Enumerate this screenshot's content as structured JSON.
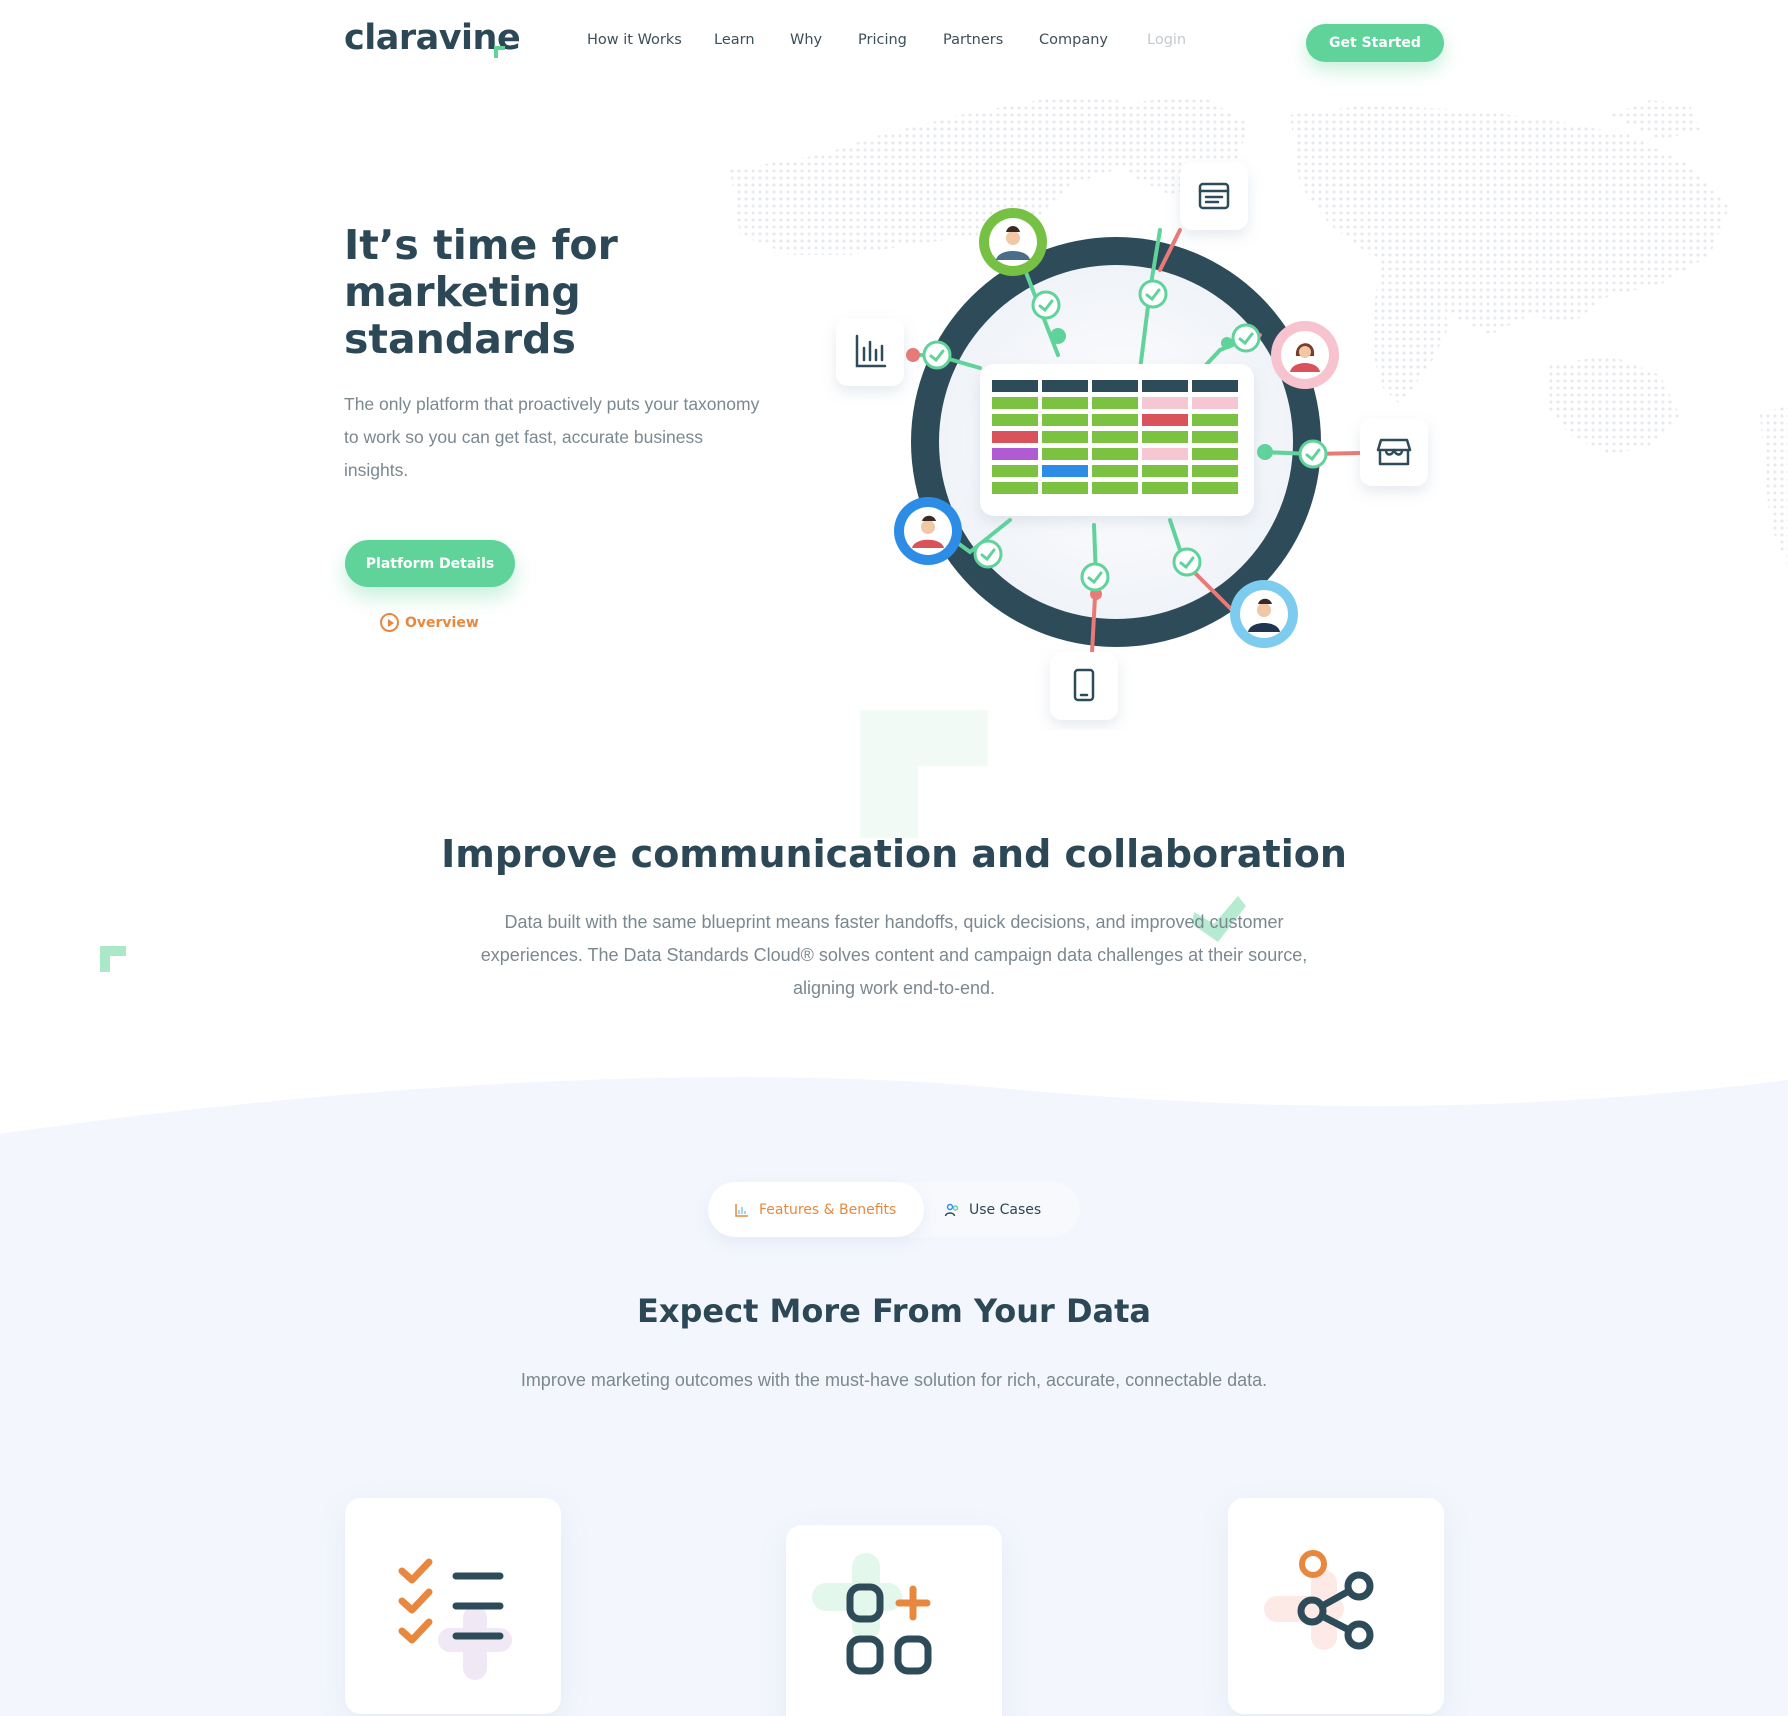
{
  "header": {
    "logo": "claravine",
    "nav": [
      "How it Works",
      "Learn",
      "Why",
      "Pricing",
      "Partners",
      "Company",
      "Login"
    ],
    "cta": "Get Started"
  },
  "hero": {
    "title": "It’s time for marketing standards",
    "subtitle": "The only platform that proactively puts your taxonomy to work so you can get fast, accurate business insights.",
    "primary_button": "Platform Details",
    "secondary_link": "Overview"
  },
  "collab": {
    "title": "Improve communication and collaboration",
    "text": "Data built with the same blueprint means faster handoffs, quick decisions, and improved customer experiences. The Data Standards Cloud® solves content and campaign data challenges at their source, aligning work end-to-end."
  },
  "features": {
    "tabs": [
      {
        "label": "Features & Benefits",
        "icon": "chart-icon",
        "active": true
      },
      {
        "label": "Use Cases",
        "icon": "users-icon",
        "active": false
      }
    ],
    "title": "Expect More From Your Data",
    "text": "Improve marketing outcomes with the must-have solution for rich, accurate, connectable data.",
    "cards": [
      {
        "icon": "checklist-icon"
      },
      {
        "icon": "add-blocks-icon"
      },
      {
        "icon": "share-nodes-icon"
      }
    ]
  },
  "colors": {
    "brand_green": "#5fd39a",
    "brand_dark": "#2c4856",
    "accent_orange": "#e8883f",
    "muted_text": "#7b8890",
    "section_bg": "#f3f6fd"
  }
}
